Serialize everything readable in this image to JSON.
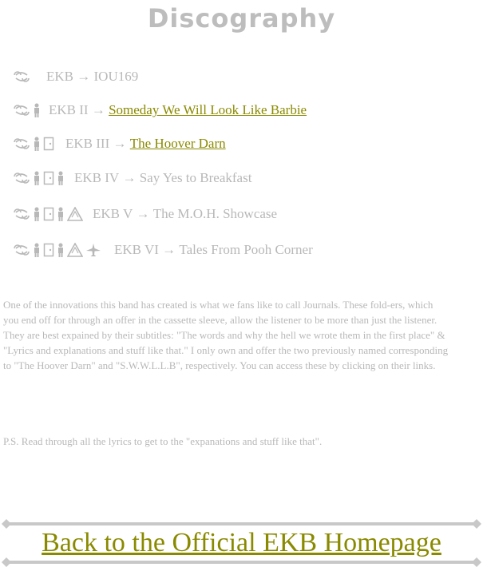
{
  "page": {
    "title": "Discography"
  },
  "albums": [
    {
      "name": "EKB",
      "arrow": "→",
      "title": "IOU169",
      "linked": false
    },
    {
      "name": "EKB II",
      "arrow": "→",
      "title": "Someday We Will Look Like Barbie",
      "linked": true
    },
    {
      "name": "EKB III",
      "arrow": "→",
      "title": "The Hoover Darn",
      "linked": true
    },
    {
      "name": "EKB IV",
      "arrow": "→",
      "title": "Say Yes to Breakfast",
      "linked": false
    },
    {
      "name": "EKB V",
      "arrow": "→",
      "title": "The M.O.H. Showcase",
      "linked": false
    },
    {
      "name": "EKB VI",
      "arrow": "→",
      "title": "Tales From Pooh Corner",
      "linked": false
    }
  ],
  "journals_paragraph": "One of the innovations this band has created is what we fans like to call Journals. These fold-ers, which you end off for through an offer in the cassette sleeve, allow the listener to be more than just the listener. They are best expained by their subtitles: \"The words and why the hell we wrote them in the first place\" & \"Lyrics and explanations and stuff like that.\"  I only own and offer the two previously named corresponding to \"The Hoover Darn\" and \"S.W.W.L.L.B\", respectively. You can access these by clicking on their links.",
  "ps_note": "P.S. Read through all the lyrics to get to the \"expanations and stuff like that\".",
  "footer": {
    "home_link": "Back to the Official EKB Homepage"
  },
  "colors": {
    "text": "#b8b8b8",
    "link": "#8a8a00",
    "rule": "#c8c8c8"
  },
  "icons": [
    "cancer-glyph-icon",
    "person-icon",
    "door-icon",
    "person-icon",
    "warning-triangle-icon",
    "airplane-icon"
  ]
}
